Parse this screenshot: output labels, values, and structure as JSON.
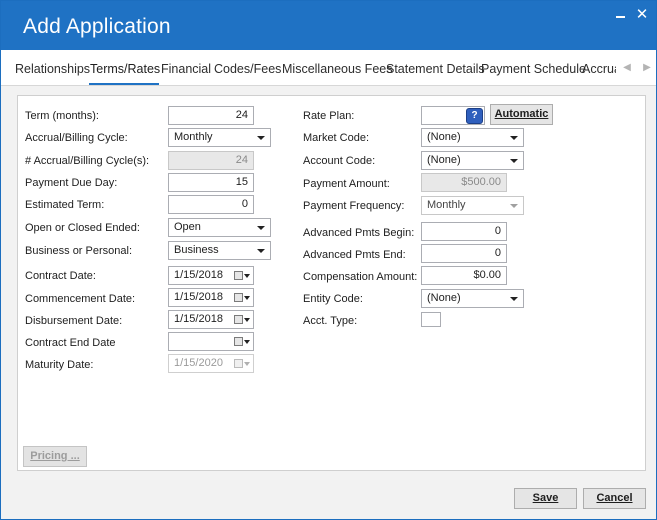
{
  "window": {
    "title": "Add Application",
    "minimize_symbol": "-",
    "close_symbol": "✕"
  },
  "tabs": [
    {
      "label": "Relationships"
    },
    {
      "label": "Terms/Rates"
    },
    {
      "label": "Financial"
    },
    {
      "label": "Codes/Fees"
    },
    {
      "label": "Miscellaneous Fees"
    },
    {
      "label": "Statement Details"
    },
    {
      "label": "Payment Schedule"
    },
    {
      "label": "Accrua"
    }
  ],
  "active_tab": "Terms/Rates",
  "left": {
    "term_label": "Term (months):",
    "term_value": "24",
    "cycle_label": "Accrual/Billing Cycle:",
    "cycle_value": "Monthly",
    "cycles_label": "# Accrual/Billing Cycle(s):",
    "cycles_value": "24",
    "due_day_label": "Payment Due Day:",
    "due_day_value": "15",
    "est_term_label": "Estimated Term:",
    "est_term_value": "0",
    "open_closed_label": "Open or Closed Ended:",
    "open_closed_value": "Open",
    "biz_personal_label": "Business or Personal:",
    "biz_personal_value": "Business",
    "contract_date_label": "Contract Date:",
    "contract_date_value": "1/15/2018",
    "commence_label": "Commencement Date:",
    "commence_value": "1/15/2018",
    "disburse_label": "Disbursement Date:",
    "disburse_value": "1/15/2018",
    "contract_end_label": "Contract End Date",
    "contract_end_value": "",
    "maturity_label": "Maturity Date:",
    "maturity_value": "1/15/2020"
  },
  "right": {
    "rate_plan_label": "Rate Plan:",
    "rate_plan_value": "",
    "help_symbol": "?",
    "automatic_button": "Automatic",
    "market_code_label": "Market Code:",
    "market_code_value": "(None)",
    "account_code_label": "Account Code:",
    "account_code_value": "(None)",
    "payment_amount_label": "Payment Amount:",
    "payment_amount_value": "$500.00",
    "payment_freq_label": "Payment Frequency:",
    "payment_freq_value": "Monthly",
    "adv_begin_label": "Advanced Pmts Begin:",
    "adv_begin_value": "0",
    "adv_end_label": "Advanced Pmts End:",
    "adv_end_value": "0",
    "comp_amount_label": "Compensation Amount:",
    "comp_amount_value": "$0.00",
    "entity_code_label": "Entity Code:",
    "entity_code_value": "(None)",
    "acct_type_label": "Acct. Type:"
  },
  "buttons": {
    "pricing": "Pricing ...",
    "save": "Save",
    "cancel": "Cancel"
  },
  "colors": {
    "titlebar": "#1f72c4",
    "tab_underline": "#1f72c4",
    "help_button": "#2f5fbd"
  }
}
